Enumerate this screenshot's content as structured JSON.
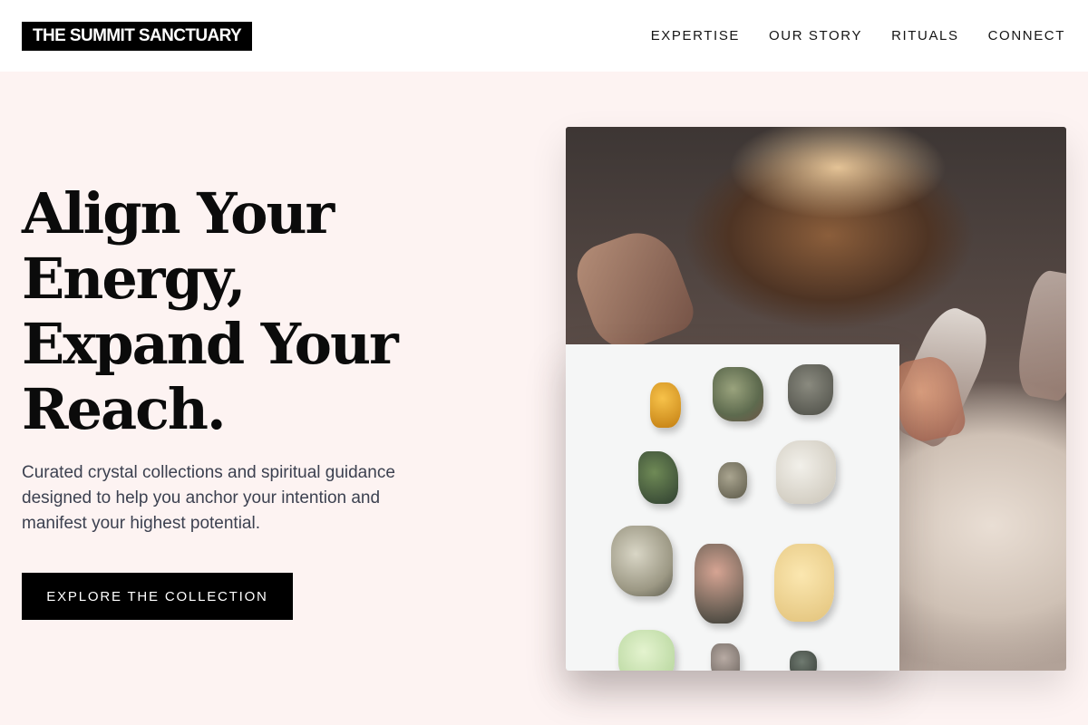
{
  "header": {
    "logo_text": "THE SUMMIT SANCTUARY",
    "nav": [
      {
        "label": "EXPERTISE"
      },
      {
        "label": "OUR STORY"
      },
      {
        "label": "RITUALS"
      },
      {
        "label": "CONNECT"
      }
    ]
  },
  "hero": {
    "title_lines": [
      "Align Your",
      "Energy,",
      "Expand Your",
      "Reach."
    ],
    "description": "Curated crystal collections and spiritual guidance designed to help you anchor your intention and manifest your highest potential.",
    "cta_label": "EXPLORE THE COLLECTION"
  },
  "colors": {
    "page_background": "#fdf3f2",
    "header_background": "#ffffff",
    "accent": "#000000",
    "body_text": "#3c4150"
  }
}
